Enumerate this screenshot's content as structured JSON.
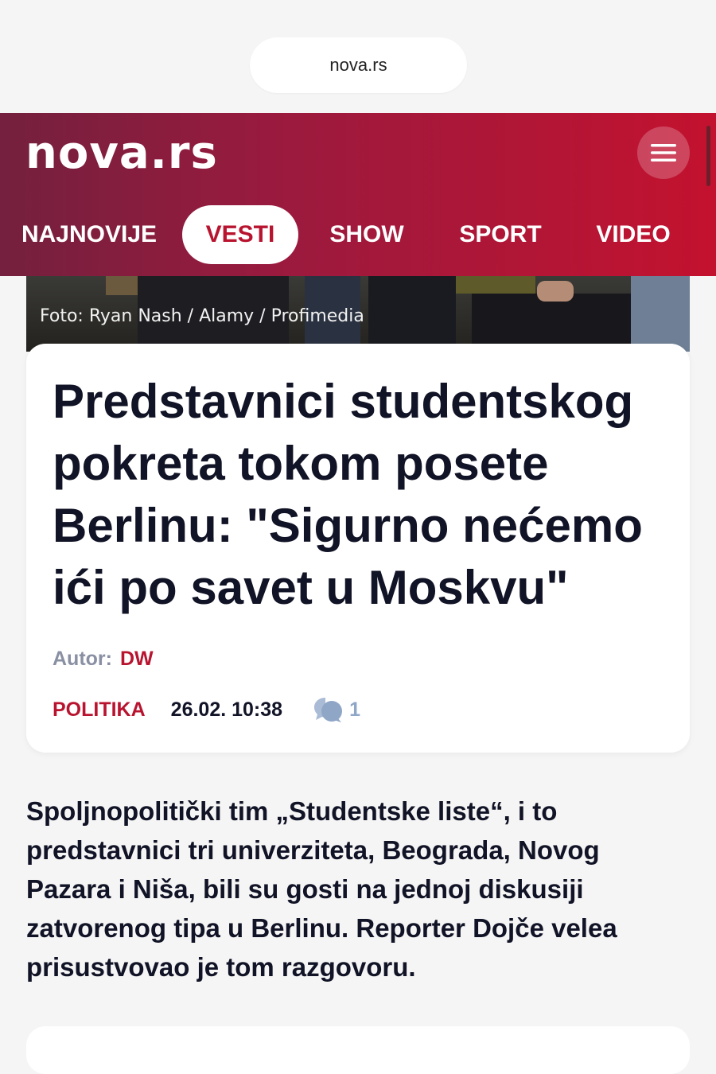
{
  "browser": {
    "url": "nova.rs"
  },
  "header": {
    "logo": "nova.rs",
    "menu_icon": "hamburger-menu-icon",
    "nav": [
      {
        "label": "NAJNOVIJE",
        "active": false
      },
      {
        "label": "VESTI",
        "active": true
      },
      {
        "label": "SHOW",
        "active": false
      },
      {
        "label": "SPORT",
        "active": false
      },
      {
        "label": "VIDEO",
        "active": false
      }
    ]
  },
  "photo": {
    "credit": "Foto: Ryan Nash / Alamy / Profimedia"
  },
  "article": {
    "title": "Predstavnici studentskog pokreta tokom posete Berlinu: \"Sigurno nećemo ići po savet u Moskvu\"",
    "author_label": "Autor:",
    "author": "DW",
    "category": "POLITIKA",
    "datetime": "26.02. 10:38",
    "comment_icon": "comment-bubbles-icon",
    "comment_count": "1",
    "lead": "Spoljnopolitički tim „Studentske liste“, i to predstavnici tri univerziteta, Beograda, Novog Pazara i Niša, bili su gosti na jednoj diskusiji zatvorenog tipa u Berlinu. Reporter Dojče velea prisustvovao je tom razgovoru."
  },
  "colors": {
    "brand": "#b8142f",
    "header_gradient_start": "#74203e",
    "header_gradient_end": "#c3122f",
    "text_dark": "#111326",
    "muted": "#8a90a3"
  }
}
